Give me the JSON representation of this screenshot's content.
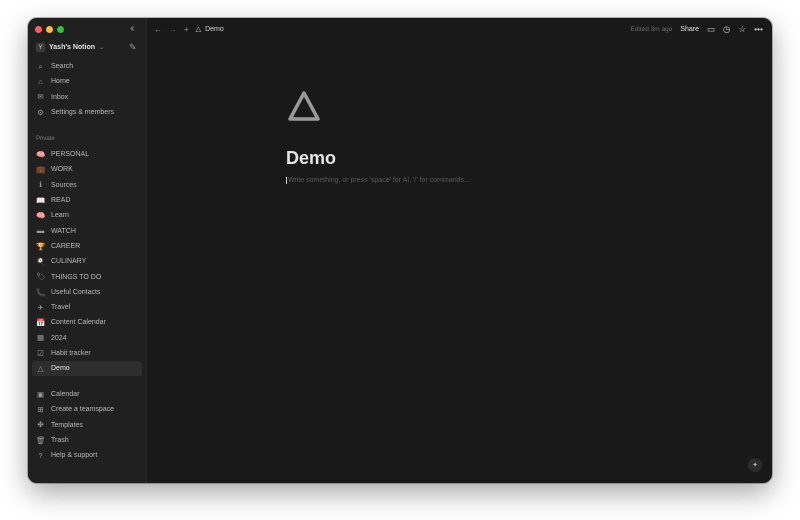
{
  "window": {
    "traffic_colors": [
      "#ff5f57",
      "#febc2e",
      "#28c840"
    ]
  },
  "sidebar": {
    "workspace": {
      "initial": "Y",
      "name": "Yash's Notion"
    },
    "top_items": [
      {
        "label": "Search",
        "icon": "search-icon"
      },
      {
        "label": "Home",
        "icon": "home-icon"
      },
      {
        "label": "Inbox",
        "icon": "inbox-icon"
      },
      {
        "label": "Settings & members",
        "icon": "gear-icon"
      }
    ],
    "section_label": "Private",
    "private_items": [
      {
        "label": "PERSONAL",
        "icon": "brain-icon",
        "glyph": "🧠"
      },
      {
        "label": "WORK",
        "icon": "briefcase-icon",
        "glyph": "💼"
      },
      {
        "label": "Sources",
        "icon": "info-icon",
        "glyph": "ℹ"
      },
      {
        "label": "READ",
        "icon": "book-icon",
        "glyph": "📖"
      },
      {
        "label": "Learn",
        "icon": "brain-icon",
        "glyph": "🧠"
      },
      {
        "label": "WATCH",
        "icon": "tv-icon",
        "glyph": "▬"
      },
      {
        "label": "CAREER",
        "icon": "trophy-icon",
        "glyph": "🏆"
      },
      {
        "label": "CULINARY",
        "icon": "chef-icon",
        "glyph": "🍳"
      },
      {
        "label": "THINGS TO DO",
        "icon": "tag-icon",
        "glyph": "🏷"
      },
      {
        "label": "Useful Contacts",
        "icon": "phone-icon",
        "glyph": "📞"
      },
      {
        "label": "Travel",
        "icon": "plane-icon",
        "glyph": "✈"
      },
      {
        "label": "Content Calendar",
        "icon": "calendar-icon",
        "glyph": "📅"
      },
      {
        "label": "2024",
        "icon": "calendar-grid-icon",
        "glyph": "▦"
      },
      {
        "label": "Habit tracker",
        "icon": "checkbox-icon",
        "glyph": "☑"
      },
      {
        "label": "Demo",
        "icon": "triangle-icon",
        "glyph": "△"
      }
    ],
    "bottom_items": [
      {
        "label": "Calendar",
        "icon": "calendar-icon"
      },
      {
        "label": "Create a teamspace",
        "icon": "teamspace-icon"
      },
      {
        "label": "Templates",
        "icon": "templates-icon"
      },
      {
        "label": "Trash",
        "icon": "trash-icon"
      },
      {
        "label": "Help & support",
        "icon": "help-icon"
      }
    ]
  },
  "topbar": {
    "breadcrumb": "Demo",
    "edited": "Edited 3m ago",
    "share": "Share"
  },
  "page": {
    "title": "Demo",
    "placeholder": "Write something, or press 'space' for AI, '/' for commands..."
  }
}
